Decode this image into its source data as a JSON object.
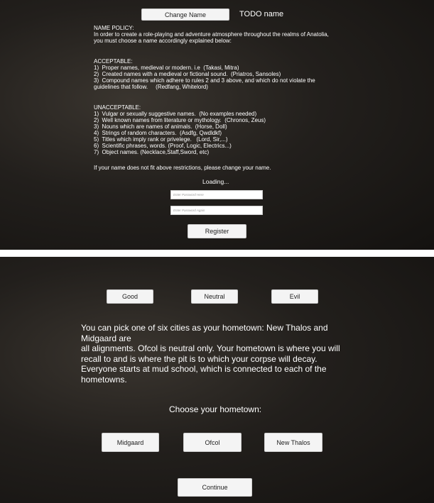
{
  "name_section": {
    "change_name_button": "Change Name",
    "current_name": "TODO name",
    "policy_lines": [
      "NAME POLICY:",
      "In order to create a role-playing and adventure atmosphere throughout the realms of Anatolia,",
      "you must choose a name accordingly explained below:"
    ],
    "acceptable_lines": [
      "ACCEPTABLE:",
      "1)  Proper names, medieval or modern. i.e  (Takasi, Mitra)",
      "2)  Created names with a medieval or fictional sound.  (Priatros, Sansoles)",
      "3)  Compound names which adhere to rules 2 and 3 above, and which do not violate the",
      "guidelines that follow.     (Redfang, Whitelord)"
    ],
    "unacceptable_lines": [
      "UNACCEPTABLE:",
      "1)  Vulgar or sexually suggestive names.  (No examples needed)",
      "2)  Well known names from literature or mythology.  (Chronos, Zeus)",
      "3)  Nouns which are names of animals.  (Horse, Doll)",
      "4)  Strings of random characters.  (Asdfg, Qwdldkf)",
      "5)  Titles which imply rank or privelege.   (Lord, Sir,...)",
      "6)  Scientific phrases, words. (Proof, Logic, Electrics...)",
      "7)  Object names. (Necklace,Staff,Sword, etc)"
    ],
    "restriction_note": "If your name does not fit above restrictions, please change your name.",
    "loading_text": "Loading...",
    "password_placeholder": "Enter Password Here",
    "password_again_placeholder": "Enter Password Again",
    "register_button": "Register"
  },
  "alignment_section": {
    "alignments": [
      "Good",
      "Neutral",
      "Evil"
    ],
    "hometown_description": "You can pick one of six cities as your hometown: New Thalos and Midgaard are\nall alignments. Ofcol is neutral only. Your hometown is where you will recall to and is where the pit is to which your corpse will decay. Everyone starts at mud school, which is connected to each of the hometowns.",
    "choose_label": "Choose your hometown:",
    "hometowns": [
      "Midgaard",
      "Ofcol",
      "New Thalos"
    ],
    "continue_button": "Continue"
  }
}
